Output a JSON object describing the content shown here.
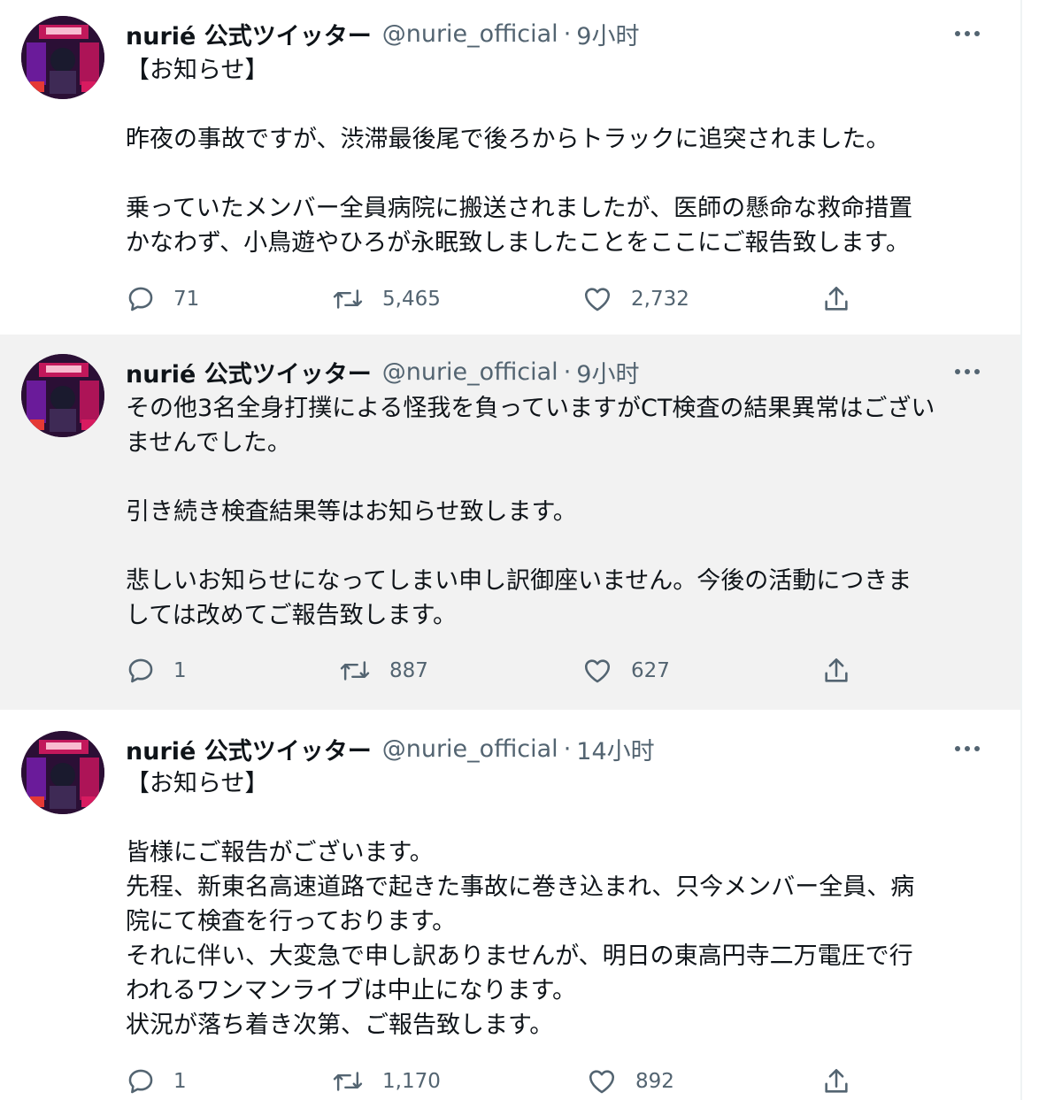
{
  "tweets": [
    {
      "name": "nurié 公式ツイッター",
      "handle": "@nurie_official",
      "separator": "·",
      "time": "9小时",
      "lines": [
        "【お知らせ】",
        "",
        "昨夜の事故ですが、渋滞最後尾で後ろからトラックに追突されました。",
        "",
        "乗っていたメンバー全員病院に搬送されましたが、医師の懸命な救命措置",
        "かなわず、小鳥遊やひろが永眠致しましたことをここにご報告致します。"
      ],
      "replies": "71",
      "retweets": "5,465",
      "likes": "2,732"
    },
    {
      "name": "nurié 公式ツイッター",
      "handle": "@nurie_official",
      "separator": "·",
      "time": "9小时",
      "lines": [
        "その他3名全身打撲による怪我を負っていますがCT検査の結果異常はござい",
        "ませんでした。",
        "",
        "引き続き検査結果等はお知らせ致します。",
        "",
        "悲しいお知らせになってしまい申し訳御座いません。今後の活動につきま",
        "しては改めてご報告致します。"
      ],
      "replies": "1",
      "retweets": "887",
      "likes": "627"
    },
    {
      "name": "nurié 公式ツイッター",
      "handle": "@nurie_official",
      "separator": "·",
      "time": "14小时",
      "lines": [
        "【お知らせ】",
        "",
        "皆様にご報告がございます。",
        "先程、新東名高速道路で起きた事故に巻き込まれ、只今メンバー全員、病",
        "院にて検査を行っております。",
        "それに伴い、大変急で申し訳ありませんが、明日の東高円寺二万電圧で行",
        "われるワンマンライブは中止になります。",
        "状況が落ち着き次第、ご報告致します。"
      ],
      "replies": "1",
      "retweets": "1,170",
      "likes": "892"
    }
  ],
  "icons": {
    "more": "more-dots-icon",
    "reply": "reply-bubble-icon",
    "retweet": "retweet-arrows-icon",
    "like": "heart-icon",
    "share": "share-upload-icon"
  },
  "colors": {
    "text_primary": "#0f1419",
    "text_secondary": "#536471",
    "thread_line": "#cfd9de",
    "highlight_background": "#f2f2f2"
  }
}
